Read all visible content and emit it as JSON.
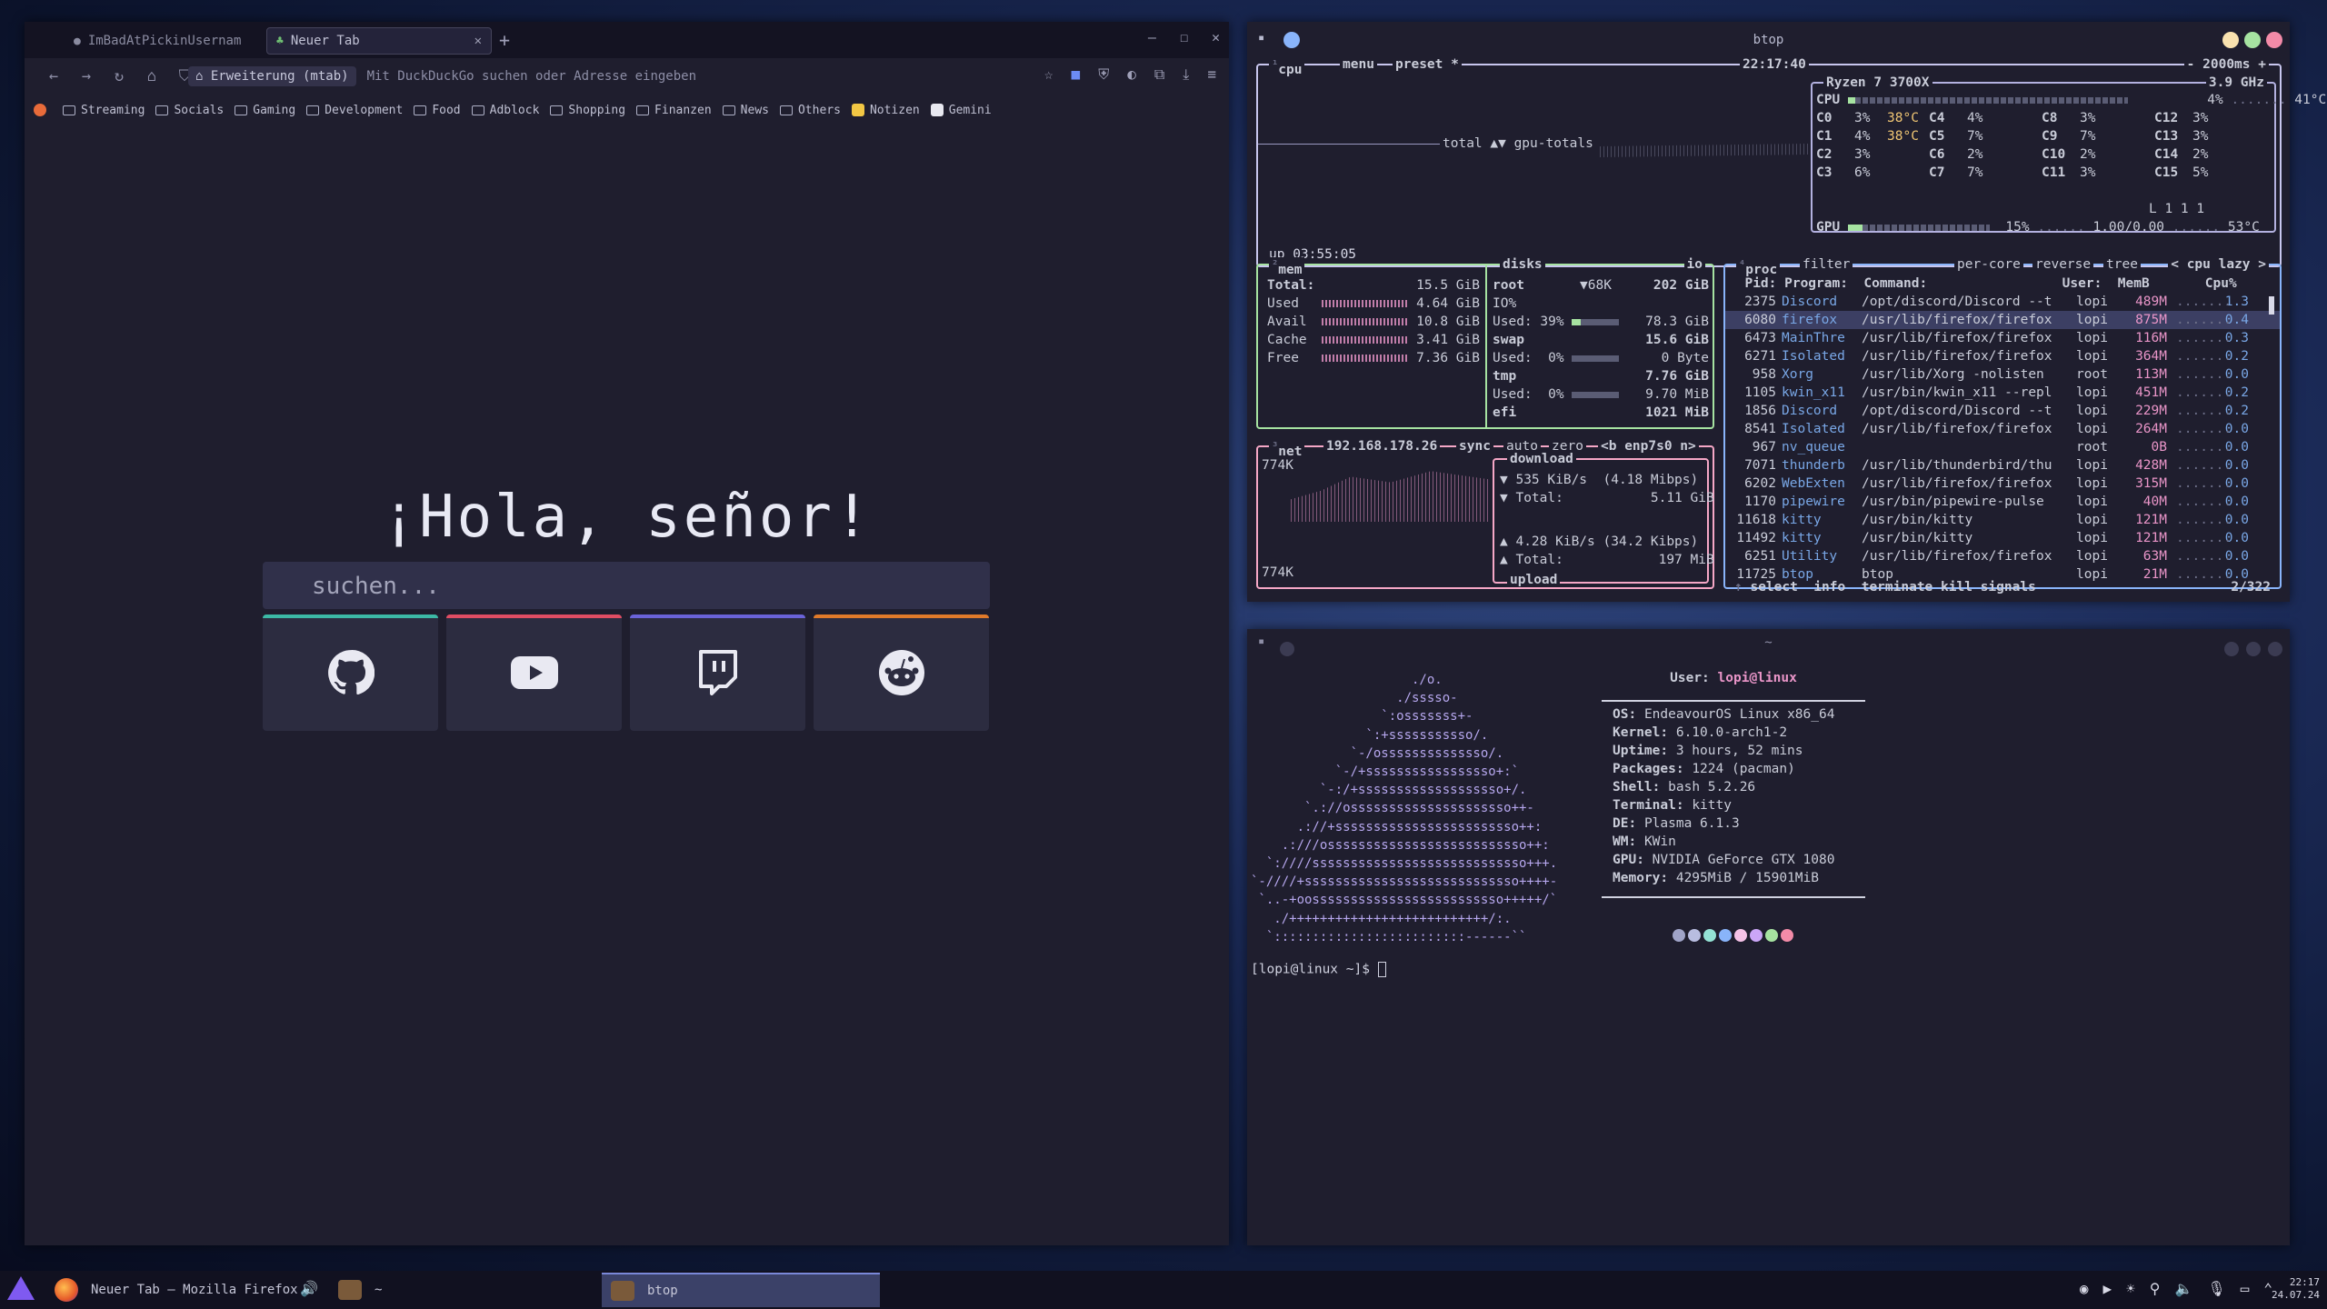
{
  "firefox": {
    "tabs": [
      {
        "label": "ImBadAtPickinUsernam",
        "active": false
      },
      {
        "label": "Neuer Tab",
        "active": true
      }
    ],
    "url_button": "Erweiterung (mtab)",
    "url_placeholder": "Mit DuckDuckGo suchen oder Adresse eingeben",
    "bookmarks": [
      "Streaming",
      "Socials",
      "Gaming",
      "Development",
      "Food",
      "Adblock",
      "Shopping",
      "Finanzen",
      "News",
      "Others",
      "Notizen",
      "Gemini"
    ],
    "greeting": "¡Hola, señor!",
    "search_placeholder": "suchen...",
    "tiles": [
      {
        "name": "github",
        "color": "#3cb9a5"
      },
      {
        "name": "youtube",
        "color": "#e04d63"
      },
      {
        "name": "twitch",
        "color": "#6a63d8"
      },
      {
        "name": "reddit",
        "color": "#e07a2a"
      }
    ]
  },
  "btop": {
    "title": "btop",
    "cpu": {
      "label": "cpu",
      "menu": "menu",
      "preset": "preset *",
      "clock": "22:17:40",
      "interval": "2000ms",
      "model": "Ryzen 7 3700X",
      "freq": "3.9 GHz",
      "total_pct": "4%",
      "temp": "41°C",
      "graph_label": "total ▲▼ gpu-totals",
      "uptime": "up 03:55:05",
      "cores": [
        [
          "C0",
          "3%",
          "38°C"
        ],
        [
          "C1",
          "4%",
          "38°C"
        ],
        [
          "C2",
          "3%",
          ""
        ],
        [
          "C3",
          "6%",
          ""
        ],
        [
          "C4",
          "4%",
          ""
        ],
        [
          "C5",
          "7%",
          ""
        ],
        [
          "C6",
          "2%",
          ""
        ],
        [
          "C7",
          "7%",
          ""
        ],
        [
          "C8",
          "3%",
          ""
        ],
        [
          "C9",
          "7%",
          ""
        ],
        [
          "C10",
          "2%",
          ""
        ],
        [
          "C11",
          "3%",
          ""
        ],
        [
          "C12",
          "3%",
          ""
        ],
        [
          "C13",
          "3%",
          ""
        ],
        [
          "C14",
          "2%",
          ""
        ],
        [
          "C15",
          "5%",
          ""
        ]
      ],
      "load": "L 1 1 1",
      "gpu": {
        "pct": "15%",
        "load": "1.00/0.00",
        "temp": "53°C"
      }
    },
    "mem": {
      "label": "mem",
      "total": "15.5 GiB",
      "rows": [
        [
          "Used",
          "4.64 GiB"
        ],
        [
          "Avail",
          "10.8 GiB"
        ],
        [
          "Cache",
          "3.41 GiB"
        ],
        [
          "Free",
          "7.36 GiB"
        ]
      ]
    },
    "disks": {
      "label": "disks",
      "io": "io",
      "root_label": "root",
      "root_io": "▼68K",
      "root_size": "202 GiB",
      "root_io_pct": "IO%",
      "root_used": "Used: 39%",
      "root_used_val": "78.3 GiB",
      "root_used_pct": 39,
      "swap": "swap",
      "swap_size": "15.6 GiB",
      "swap_used": "Used:  0%",
      "swap_used_val": "0 Byte",
      "tmp": "tmp",
      "tmp_size": "7.76 GiB",
      "tmp_used": "Used:  0%",
      "tmp_used_val": "9.70 MiB",
      "efi": "efi",
      "efi_size": "1021 MiB"
    },
    "net": {
      "label": "net",
      "ip": "192.168.178.26",
      "sync": "sync",
      "auto": "auto",
      "zero": "zero",
      "iface": "<b enp7s0 n>",
      "scale_top": "774K",
      "scale_bottom": "774K",
      "download": "download",
      "down_rate": "▼ 535 KiB/s  (4.18 Mibps)",
      "down_total": "▼ Total:           5.11 GiB",
      "up_rate": "▲ 4.28 KiB/s (34.2 Kibps)",
      "up_total": "▲ Total:            197 MiB",
      "upload": "upload"
    },
    "proc": {
      "label": "proc",
      "filter": "filter",
      "percore": "per-core",
      "reverse": "reverse",
      "tree": "tree",
      "sort": "< cpu lazy >",
      "header": "  Pid: Program:  Command:                 User:  MemB       Cpu%",
      "rows": [
        [
          "2375",
          "Discord",
          "/opt/discord/Discord --t",
          "lopi",
          "489M",
          "1.3"
        ],
        [
          "6080",
          "firefox",
          "/usr/lib/firefox/firefox",
          "lopi",
          "875M",
          "0.4"
        ],
        [
          "6473",
          "MainThre",
          "/usr/lib/firefox/firefox",
          "lopi",
          "116M",
          "0.3"
        ],
        [
          "6271",
          "Isolated",
          "/usr/lib/firefox/firefox",
          "lopi",
          "364M",
          "0.2"
        ],
        [
          "958",
          "Xorg",
          "/usr/lib/Xorg -nolisten",
          "root",
          "113M",
          "0.0"
        ],
        [
          "1105",
          "kwin_x11",
          "/usr/bin/kwin_x11 --repl",
          "lopi",
          "451M",
          "0.2"
        ],
        [
          "1856",
          "Discord",
          "/opt/discord/Discord --t",
          "lopi",
          "229M",
          "0.2"
        ],
        [
          "8541",
          "Isolated",
          "/usr/lib/firefox/firefox",
          "lopi",
          "264M",
          "0.0"
        ],
        [
          "967",
          "nv_queue",
          "",
          "root",
          "0B",
          "0.0"
        ],
        [
          "7071",
          "thunderb",
          "/usr/lib/thunderbird/thu",
          "lopi",
          "428M",
          "0.0"
        ],
        [
          "6202",
          "WebExten",
          "/usr/lib/firefox/firefox",
          "lopi",
          "315M",
          "0.0"
        ],
        [
          "1170",
          "pipewire",
          "/usr/bin/pipewire-pulse",
          "lopi",
          "40M",
          "0.0"
        ],
        [
          "11618",
          "kitty",
          "/usr/bin/kitty",
          "lopi",
          "121M",
          "0.0"
        ],
        [
          "11492",
          "kitty",
          "/usr/bin/kitty",
          "lopi",
          "121M",
          "0.0"
        ],
        [
          "6251",
          "Utility",
          "/usr/lib/firefox/firefox",
          "lopi",
          "63M",
          "0.0"
        ],
        [
          "11725",
          "btop",
          "btop",
          "lopi",
          "21M",
          "0.0"
        ]
      ],
      "footer": {
        "select": "select",
        "info": "info",
        "terminate": "terminate",
        "kill": "kill",
        "signals": "signals",
        "count": "2/322"
      }
    }
  },
  "kitty": {
    "title": "~",
    "ascii": [
      "                     ./o.",
      "                   ./sssso-",
      "                 `:osssssss+-",
      "               `:+sssssssssso/.",
      "             `-/ossssssssssssso/.",
      "           `-/+sssssssssssssssso+:`",
      "         `-:/+sssssssssssssssssso+/.",
      "       `.://osssssssssssssssssssso++-",
      "      .://+ssssssssssssssssssssssso++:",
      "    .:///ossssssssssssssssssssssssso++:",
      "  `:////ssssssssssssssssssssssssssso+++.",
      "`-////+ssssssssssssssssssssssssssso++++-",
      " `..-+oosssssssssssssssssssssssso+++++/`",
      "   ./++++++++++++++++++++++++++/:.",
      "  `:::::::::::::::::::::::::------``"
    ],
    "user_label": "User:",
    "user": "lopi@linux",
    "info": [
      [
        "OS:",
        "EndeavourOS Linux x86_64"
      ],
      [
        "Kernel:",
        "6.10.0-arch1-2"
      ],
      [
        "Uptime:",
        "3 hours, 52 mins"
      ],
      [
        "Packages:",
        "1224 (pacman)"
      ],
      [
        "Shell:",
        "bash 5.2.26"
      ],
      [
        "Terminal:",
        "kitty"
      ],
      [
        "DE:",
        "Plasma 6.1.3"
      ],
      [
        "WM:",
        "KWin"
      ],
      [
        "GPU:",
        "NVIDIA GeForce GTX 1080"
      ],
      [
        "Memory:",
        "4295MiB / 15901MiB"
      ]
    ],
    "palette": [
      "#a0a4c8",
      "#b8bde0",
      "#94e2d5",
      "#89b4fa",
      "#f5c2e7",
      "#cba6f7",
      "#a6e3a1",
      "#f38ba8"
    ],
    "prompt": "[lopi@linux ~]$ "
  },
  "taskbar": {
    "firefox_task": "Neuer Tab — Mozilla Firefox",
    "kitty_task": "~",
    "btop_task": "btop",
    "time": "22:17",
    "date": "24.07.24"
  }
}
